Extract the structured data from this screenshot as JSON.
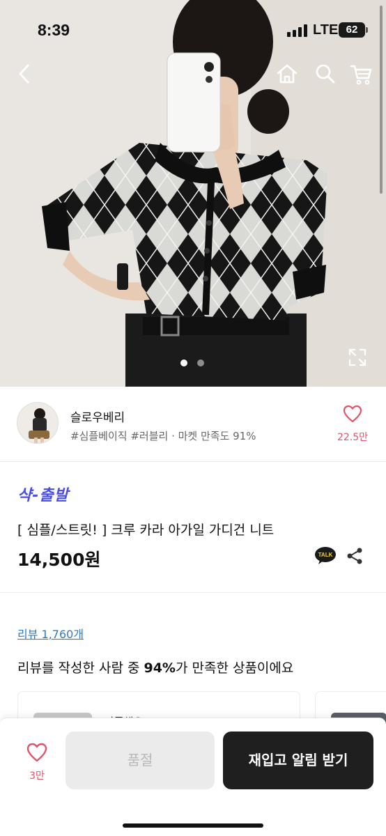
{
  "status_bar": {
    "time": "8:39",
    "network": "LTE",
    "battery": "62"
  },
  "nav": {
    "back_icon": "chevron-left-icon",
    "home_icon": "home-icon",
    "search_icon": "search-icon",
    "cart_icon": "cart-icon"
  },
  "gallery": {
    "current_slide": 1,
    "total_slides": 2,
    "expand_icon": "expand-icon"
  },
  "seller": {
    "name": "슬로우베리",
    "tags": "#심플베이직 #러블리 · 마켓 만족도 91%",
    "like_count": "22.5만"
  },
  "product": {
    "badge": "샥-출발",
    "title": "[ 심플/스트릿! ] 크루 카라 아가일 가디건 니트",
    "price": "14,500원",
    "talk_label": "TALK"
  },
  "review": {
    "link": "리뷰 1,760개",
    "summary_prefix": "리뷰를 작성한 사람 중 ",
    "summary_percent": "94%",
    "summary_suffix": "가 만족한 상품이에요",
    "card_peek": "만족해요"
  },
  "bottom_bar": {
    "wish_count": "3만",
    "soldout_label": "품절",
    "restock_label": "재입고 알림 받기"
  },
  "colors": {
    "accent_pink": "#e0546a",
    "badge_blue": "#4b4ee5",
    "link_blue": "#2f78c4",
    "primary_button": "#1f1f1f",
    "disabled_button": "#ebebeb"
  }
}
